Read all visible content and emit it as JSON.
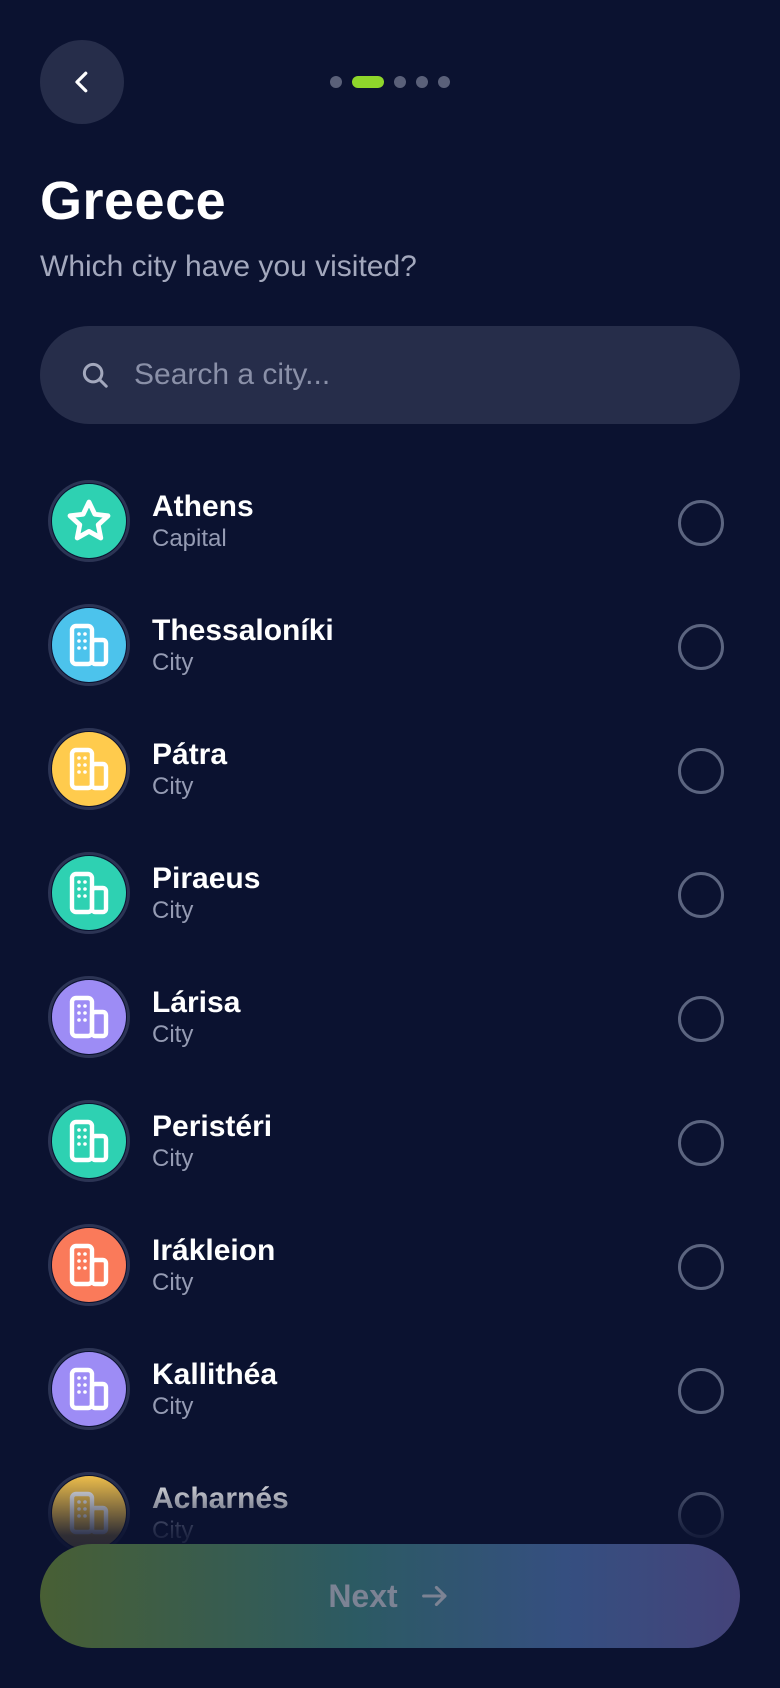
{
  "header": {
    "back_icon": "chevron-left-icon",
    "progress": {
      "total_steps": 5,
      "current_step": 2
    }
  },
  "title": "Greece",
  "subtitle": "Which city have you visited?",
  "search": {
    "placeholder": "Search a city...",
    "value": ""
  },
  "cities": [
    {
      "name": "Athens",
      "type": "Capital",
      "icon": "star-icon",
      "color": "#2ed1b2",
      "selected": false
    },
    {
      "name": "Thessaloníki",
      "type": "City",
      "icon": "building-icon",
      "color": "#4cc3ec",
      "selected": false
    },
    {
      "name": "Pátra",
      "type": "City",
      "icon": "building-icon",
      "color": "#ffcb4d",
      "selected": false
    },
    {
      "name": "Piraeus",
      "type": "City",
      "icon": "building-icon",
      "color": "#2ed1b2",
      "selected": false
    },
    {
      "name": "Lárisa",
      "type": "City",
      "icon": "building-icon",
      "color": "#9d8cf5",
      "selected": false
    },
    {
      "name": "Peristéri",
      "type": "City",
      "icon": "building-icon",
      "color": "#2ed1b2",
      "selected": false
    },
    {
      "name": "Irákleion",
      "type": "City",
      "icon": "building-icon",
      "color": "#fa7a5a",
      "selected": false
    },
    {
      "name": "Kallithéa",
      "type": "City",
      "icon": "building-icon",
      "color": "#9d8cf5",
      "selected": false
    },
    {
      "name": "Acharnés",
      "type": "City",
      "icon": "building-icon",
      "color": "#ffcb4d",
      "selected": false
    }
  ],
  "footer": {
    "next_label": "Next",
    "next_icon": "arrow-right-icon"
  }
}
